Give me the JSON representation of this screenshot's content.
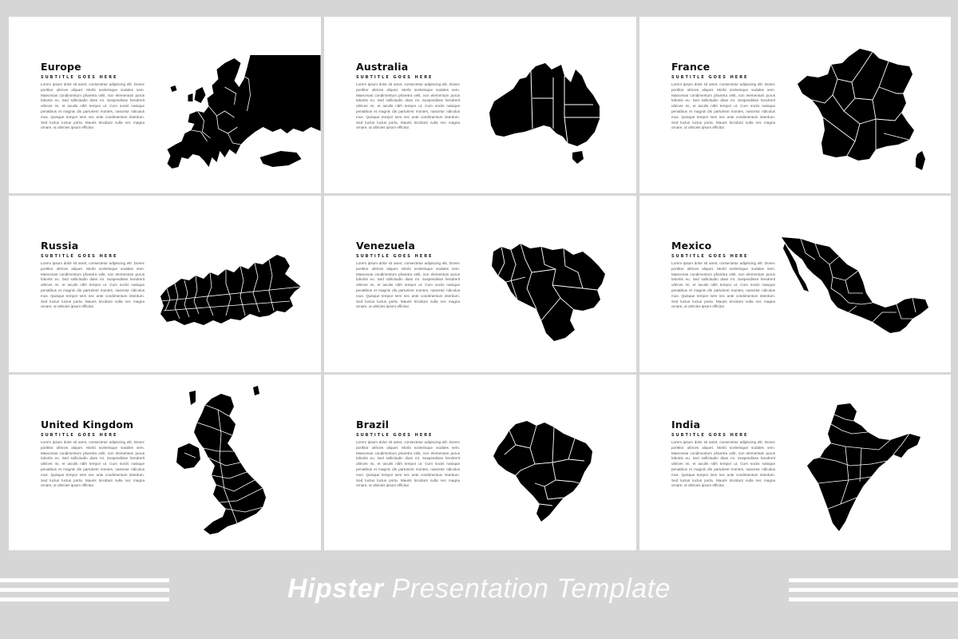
{
  "slides": [
    {
      "title": "Europe",
      "subtitle": "SUBTITLE GOES HERE",
      "body": "Lorem ipsum dolor sit amet, consectetur adipiscing elit. Donec porttitor ultrices aliquet. Morbi scelerisque sodales sem. Maecenas condimentum pharetra velit, non elementum purus lobortis eu. Sed sollicitudin diam mi. Suspendisse hendrerit ultrices mi, et iaculis nibh tempor ut. Cum sociis natoque penatibus et magnis dis parturient montes, nascetur ridiculus mus. Quisque tempor sem nec ante condimentum interdum. Sed luctus luctus porta. Mauris tincidunt nulla nec magna ornare, ut ultricies ipsum efficitur.",
      "map_icon": "europe-map"
    },
    {
      "title": "Australia",
      "subtitle": "SUBTITLE GOES HERE",
      "body": "Lorem ipsum dolor sit amet, consectetur adipiscing elit. Donec porttitor ultrices aliquet. Morbi scelerisque sodales sem. Maecenas condimentum pharetra velit, non elementum purus lobortis eu. Sed sollicitudin diam mi. Suspendisse hendrerit ultrices mi, et iaculis nibh tempor ut. Cum sociis natoque penatibus et magnis dis parturient montes, nascetur ridiculus mus. Quisque tempor sem nec ante condimentum interdum. Sed luctus luctus porta. Mauris tincidunt nulla nec magna ornare, ut ultricies ipsum efficitur.",
      "map_icon": "australia-map"
    },
    {
      "title": "France",
      "subtitle": "SUBTITLE GOES HERE",
      "body": "Lorem ipsum dolor sit amet, consectetur adipiscing elit. Donec porttitor ultrices aliquet. Morbi scelerisque sodales sem. Maecenas condimentum pharetra velit, non elementum purus lobortis eu. Sed sollicitudin diam mi. Suspendisse hendrerit ultrices mi, et iaculis nibh tempor ut. Cum sociis natoque penatibus et magnis dis parturient montes, nascetur ridiculus mus. Quisque tempor sem nec ante condimentum interdum. Sed luctus luctus porta. Mauris tincidunt nulla nec magna ornare, ut ultricies ipsum efficitur.",
      "map_icon": "france-map"
    },
    {
      "title": "Russia",
      "subtitle": "SUBTITLE GOES HERE",
      "body": "Lorem ipsum dolor sit amet, consectetur adipiscing elit. Donec porttitor ultrices aliquet. Morbi scelerisque sodales sem. Maecenas condimentum pharetra velit, non elementum purus lobortis eu. Sed sollicitudin diam mi. Suspendisse hendrerit ultrices mi, et iaculis nibh tempor ut. Cum sociis natoque penatibus et magnis dis parturient montes, nascetur ridiculus mus. Quisque tempor sem nec ante condimentum interdum. Sed luctus luctus porta. Mauris tincidunt nulla nec magna ornare, ut ultricies ipsum efficitur.",
      "map_icon": "russia-map"
    },
    {
      "title": "Venezuela",
      "subtitle": "SUBTITLE GOES HERE",
      "body": "Lorem ipsum dolor sit amet, consectetur adipiscing elit. Donec porttitor ultrices aliquet. Morbi scelerisque sodales sem. Maecenas condimentum pharetra velit, non elementum purus lobortis eu. Sed sollicitudin diam mi. Suspendisse hendrerit ultrices mi, et iaculis nibh tempor ut. Cum sociis natoque penatibus et magnis dis parturient montes, nascetur ridiculus mus. Quisque tempor sem nec ante condimentum interdum. Sed luctus luctus porta. Mauris tincidunt nulla nec magna ornare, ut ultricies ipsum efficitur.",
      "map_icon": "venezuela-map"
    },
    {
      "title": "Mexico",
      "subtitle": "SUBTITLE GOES HERE",
      "body": "Lorem ipsum dolor sit amet, consectetur adipiscing elit. Donec porttitor ultrices aliquet. Morbi scelerisque sodales sem. Maecenas condimentum pharetra velit, non elementum purus lobortis eu. Sed sollicitudin diam mi. Suspendisse hendrerit ultrices mi, et iaculis nibh tempor ut. Cum sociis natoque penatibus et magnis dis parturient montes, nascetur ridiculus mus. Quisque tempor sem nec ante condimentum interdum. Sed luctus luctus porta. Mauris tincidunt nulla nec magna ornare, ut ultricies ipsum efficitur.",
      "map_icon": "mexico-map"
    },
    {
      "title": "United Kingdom",
      "subtitle": "SUBTITLE GOES HERE",
      "body": "Lorem ipsum dolor sit amet, consectetur adipiscing elit. Donec porttitor ultrices aliquet. Morbi scelerisque sodales sem. Maecenas condimentum pharetra velit, non elementum purus lobortis eu. Sed sollicitudin diam mi. Suspendisse hendrerit ultrices mi, et iaculis nibh tempor ut. Cum sociis natoque penatibus et magnis dis parturient montes, nascetur ridiculus mus. Quisque tempor sem nec ante condimentum interdum. Sed luctus luctus porta. Mauris tincidunt nulla nec magna ornare, ut ultricies ipsum efficitur.",
      "map_icon": "united-kingdom-map"
    },
    {
      "title": "Brazil",
      "subtitle": "SUBTITLE GOES HERE",
      "body": "Lorem ipsum dolor sit amet, consectetur adipiscing elit. Donec porttitor ultrices aliquet. Morbi scelerisque sodales sem. Maecenas condimentum pharetra velit, non elementum purus lobortis eu. Sed sollicitudin diam mi. Suspendisse hendrerit ultrices mi, et iaculis nibh tempor ut. Cum sociis natoque penatibus et magnis dis parturient montes, nascetur ridiculus mus. Quisque tempor sem nec ante condimentum interdum. Sed luctus luctus porta. Mauris tincidunt nulla nec magna ornare, ut ultricies ipsum efficitur.",
      "map_icon": "brazil-map"
    },
    {
      "title": "India",
      "subtitle": "SUBTITLE GOES HERE",
      "body": "Lorem ipsum dolor sit amet, consectetur adipiscing elit. Donec porttitor ultrices aliquet. Morbi scelerisque sodales sem. Maecenas condimentum pharetra velit, non elementum purus lobortis eu. Sed sollicitudin diam mi. Suspendisse hendrerit ultrices mi, et iaculis nibh tempor ut. Cum sociis natoque penatibus et magnis dis parturient montes, nascetur ridiculus mus. Quisque tempor sem nec ante condimentum interdum. Sed luctus luctus porta. Mauris tincidunt nulla nec magna ornare, ut ultricies ipsum efficitur.",
      "map_icon": "india-map"
    }
  ],
  "footer": {
    "title_strong": "Hipster",
    "title_light": "Presentation Template"
  },
  "colors": {
    "background": "#d6d6d6",
    "slide": "#ffffff",
    "map_fill": "#000000",
    "footer_text": "#ffffff"
  }
}
